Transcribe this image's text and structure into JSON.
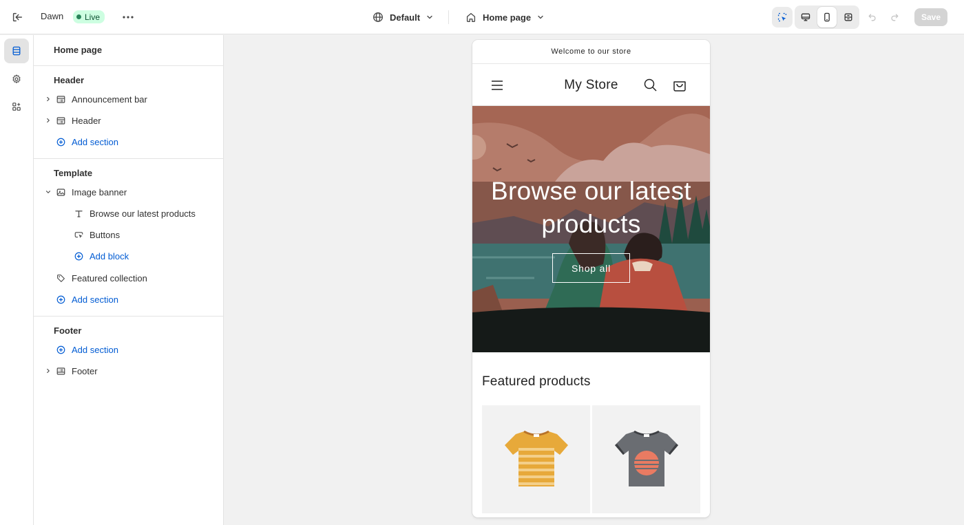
{
  "topbar": {
    "theme_name": "Dawn",
    "status_badge": "Live",
    "locale_selector": "Default",
    "page_selector": "Home page",
    "save_label": "Save"
  },
  "sidebar": {
    "title": "Home page",
    "groups": [
      {
        "title": "Header",
        "items": [
          {
            "label": "Announcement bar"
          },
          {
            "label": "Header"
          },
          {
            "label": "Add section"
          }
        ]
      },
      {
        "title": "Template",
        "items": [
          {
            "label": "Image banner"
          },
          {
            "label": "Browse our latest products"
          },
          {
            "label": "Buttons"
          },
          {
            "label": "Add block"
          },
          {
            "label": "Featured collection"
          },
          {
            "label": "Add section"
          }
        ]
      },
      {
        "title": "Footer",
        "items": [
          {
            "label": "Add section"
          },
          {
            "label": "Footer"
          }
        ]
      }
    ]
  },
  "preview": {
    "announcement": "Welcome to our store",
    "store_name": "My Store",
    "banner_heading": "Browse our latest products",
    "banner_button": "Shop all",
    "featured_title": "Featured products"
  },
  "colors": {
    "accent_link": "#005bd3",
    "live_badge_bg": "#cdfee1",
    "live_dot": "#29845a",
    "canvas_bg": "#f1f1f1"
  },
  "icons": {
    "rail": [
      "sections-icon",
      "settings-gear-icon",
      "apps-icon"
    ],
    "viewports": [
      "desktop-icon",
      "mobile-icon",
      "fullscreen-icon"
    ]
  }
}
